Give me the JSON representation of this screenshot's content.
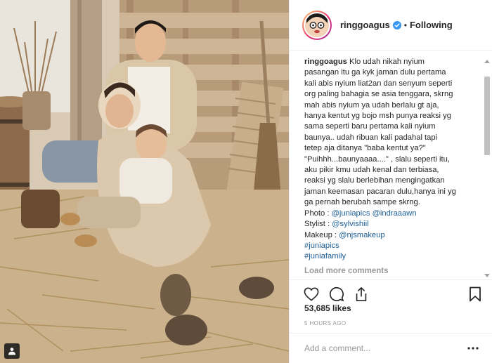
{
  "post": {
    "username": "ringgoagus",
    "follow_separator": "•",
    "follow_status": "Following",
    "caption_lines": [
      "Klo udah nikah nyium",
      "pasangan itu ga kyk jaman dulu pertama",
      "kali abis nyium liat2an dan senyum seperti",
      "org paling bahagia se asia tenggara, skrng",
      "mah abis nyium ya udah berlalu gt aja,",
      "hanya kentut yg bojo msh punya reaksi yg",
      "sama seperti baru pertama kali nyium",
      "baunya.. udah ribuan kali padahal tapi",
      "tetep aja ditanya \"baba kentut ya?\"",
      "\"Puihhh...baunyaaaa....\" , slalu seperti itu,",
      "aku pikir kmu udah kenal dan terbiasa,",
      "reaksi yg slalu berlebihan mengingatkan",
      "jaman keemasan pacaran dulu,hanya ini yg",
      "ga pernah berubah sampe skrng."
    ],
    "credits": {
      "photo_label": "Photo : ",
      "photo_tag_1": "@juniapics",
      "photo_tag_2": "@indraaawn",
      "stylist_label": "Stylist : ",
      "stylist_tag": "@sylvishiil",
      "makeup_label": "Makeup : ",
      "makeup_tag": "@njsmakeup"
    },
    "hashtags": [
      "#juniapics",
      "#juniafamily"
    ],
    "load_more": "Load more comments",
    "likes": "53,685 likes",
    "timestamp": "5 HOURS AGO",
    "add_comment_placeholder": "Add a comment...",
    "more_options": "•••"
  },
  "icons": {
    "verified": "verified-badge-icon",
    "like": "heart-icon",
    "comment": "comment-bubble-icon",
    "share": "share-icon",
    "save": "bookmark-icon",
    "more": "more-options-icon",
    "tagged": "user-tag-icon"
  },
  "colors": {
    "link": "#1a5d97",
    "verified": "#3897f0",
    "muted": "#999999",
    "text": "#262626",
    "divider": "#efefef"
  }
}
